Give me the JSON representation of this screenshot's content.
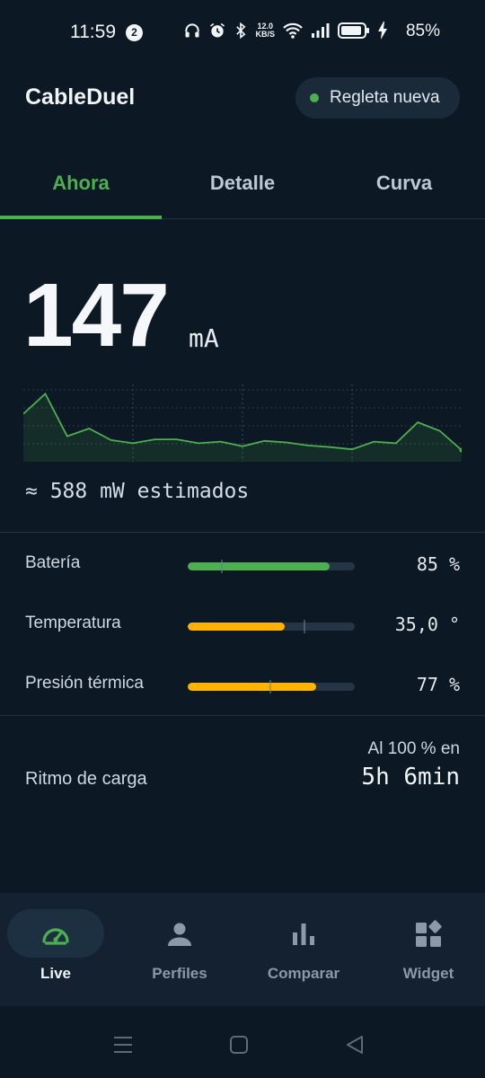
{
  "status_bar": {
    "time": "11:59",
    "notification_count": "2",
    "net_speed": "12.0",
    "net_unit": "KB/S",
    "battery": "85%"
  },
  "app": {
    "title": "CableDuel",
    "device_chip": {
      "label": "Regleta nueva",
      "status_color": "#4caf50"
    }
  },
  "tabs": [
    {
      "label": "Ahora",
      "active": true
    },
    {
      "label": "Detalle",
      "active": false
    },
    {
      "label": "Curva",
      "active": false
    }
  ],
  "reading": {
    "value": "147",
    "unit": "mA",
    "estimate": "≈ 588 mW estimados",
    "sparkline": [
      122,
      148,
      93,
      103,
      88,
      84,
      89,
      89,
      84,
      86,
      80,
      87,
      85,
      81,
      79,
      76,
      86,
      84,
      111,
      100,
      75
    ]
  },
  "metrics": [
    {
      "label": "Batería",
      "value": "85 %",
      "level": 0.85,
      "color": "#4caf50"
    },
    {
      "label": "Temperatura",
      "value": "35,0 °",
      "level": 0.58,
      "color": "#ffb300"
    },
    {
      "label": "Presión térmica",
      "value": "77 %",
      "level": 0.77,
      "color": "#ffb300"
    }
  ],
  "charge_rate": {
    "label": "Ritmo de carga",
    "caption": "Al 100 % en",
    "value": "5h 6min"
  },
  "nav": [
    {
      "label": "Live",
      "icon": "speedometer-icon",
      "active": true
    },
    {
      "label": "Perfiles",
      "icon": "person-icon",
      "active": false
    },
    {
      "label": "Comparar",
      "icon": "bar-chart-icon",
      "active": false
    },
    {
      "label": "Widget",
      "icon": "widgets-icon",
      "active": false
    }
  ],
  "colors": {
    "accent": "#4caf50",
    "warning": "#ffb300",
    "background": "#0c1824"
  }
}
